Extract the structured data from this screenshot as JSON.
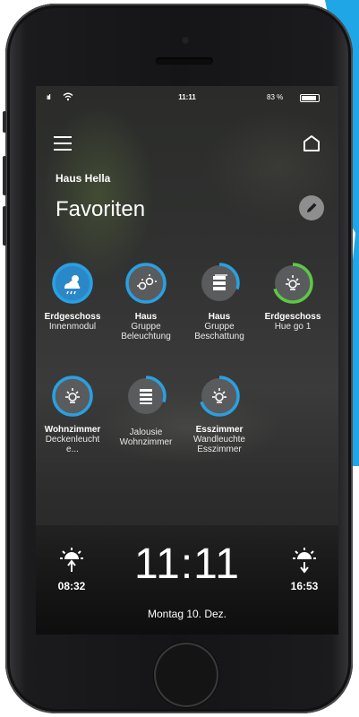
{
  "colors": {
    "accent": "#2aa0e0",
    "accent_green": "#5cc845",
    "tile_bg": "#5a5b5d",
    "tile_bg_active": "#2b88c8",
    "stripe": "#1fa6e6"
  },
  "statusbar": {
    "signal": "ııl",
    "time": "11:11",
    "battery": "83 %"
  },
  "header": {
    "menu_icon": "hamburger-menu-icon",
    "home_icon": "home-icon"
  },
  "house": {
    "name": "Haus Hella"
  },
  "page": {
    "title": "Favoriten",
    "edit_icon": "pencil-icon"
  },
  "favorites": [
    {
      "bold": "Erdgeschoss",
      "lines": [
        "Innenmodul"
      ],
      "icon": "weather-cloud-sun-icon",
      "level": 1.0,
      "ring": "accent",
      "filled": true
    },
    {
      "bold": "Haus",
      "lines": [
        "Gruppe",
        "Beleuchtung"
      ],
      "icon": "light-group-icon",
      "level": 1.0,
      "ring": "accent",
      "filled": false
    },
    {
      "bold": "Haus",
      "lines": [
        "Gruppe",
        "Beschattung"
      ],
      "icon": "shade-group-icon",
      "level": 0.3,
      "ring": "accent",
      "filled": false
    },
    {
      "bold": "Erdgeschoss",
      "lines": [
        "Hue go 1"
      ],
      "icon": "light-bulb-icon",
      "level": 0.7,
      "ring": "accent_green",
      "filled": false
    },
    {
      "bold": "Wohnzimmer",
      "lines": [
        "Deckenleucht",
        "e..."
      ],
      "icon": "light-bulb-icon",
      "level": 1.0,
      "ring": "accent",
      "filled": false
    },
    {
      "bold": "",
      "lines": [
        "Jalousie",
        "Wohnzimmer"
      ],
      "icon": "blinds-icon",
      "level": 0.3,
      "ring": "accent",
      "filled": false
    },
    {
      "bold": "Esszimmer",
      "lines": [
        "Wandleuchte",
        "Esszimmer"
      ],
      "icon": "light-bulb-icon",
      "level": 0.7,
      "ring": "accent",
      "filled": false
    }
  ],
  "sun": {
    "sunrise": "08:32",
    "sunset": "16:53",
    "sunrise_icon": "sunrise-icon",
    "sunset_icon": "sunset-icon"
  },
  "clock": {
    "time": "11:11",
    "date": "Montag 10. Dez."
  }
}
